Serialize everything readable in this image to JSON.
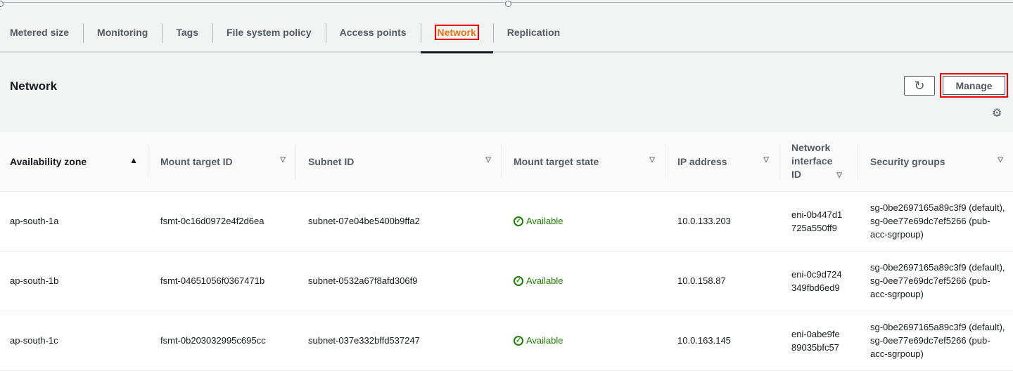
{
  "tabs": [
    {
      "label": "Metered size"
    },
    {
      "label": "Monitoring"
    },
    {
      "label": "Tags"
    },
    {
      "label": "File system policy"
    },
    {
      "label": "Access points"
    },
    {
      "label": "Network",
      "active": true
    },
    {
      "label": "Replication"
    }
  ],
  "panel": {
    "title": "Network",
    "manage_label": "Manage",
    "refresh_icon": "↻",
    "settings_icon": "⚙"
  },
  "columns": [
    "Availability zone",
    "Mount target ID",
    "Subnet ID",
    "Mount target state",
    "IP address",
    "Network interface ID",
    "Security groups"
  ],
  "rows": [
    {
      "az": "ap-south-1a",
      "mt": "fsmt-0c16d0972e4f2d6ea",
      "subnet": "subnet-07e04be5400b9ffa2",
      "state": "Available",
      "ip": "10.0.133.203",
      "eni": "eni-0b447d1725a550ff9",
      "sg": "sg-0be2697165a89c3f9 (default), sg-0ee77e69dc7ef5266 (pub-acc-sgrpoup)"
    },
    {
      "az": "ap-south-1b",
      "mt": "fsmt-04651056f0367471b",
      "subnet": "subnet-0532a67f8afd306f9",
      "state": "Available",
      "ip": "10.0.158.87",
      "eni": "eni-0c9d724349fbd6ed9",
      "sg": "sg-0be2697165a89c3f9 (default), sg-0ee77e69dc7ef5266 (pub-acc-sgrpoup)"
    },
    {
      "az": "ap-south-1c",
      "mt": "fsmt-0b203032995c695cc",
      "subnet": "subnet-037e332bffd537247",
      "state": "Available",
      "ip": "10.0.163.145",
      "eni": "eni-0abe9fe89035bfc57",
      "sg": "sg-0be2697165a89c3f9 (default), sg-0ee77e69dc7ef5266 (pub-acc-sgrpoup)"
    }
  ]
}
